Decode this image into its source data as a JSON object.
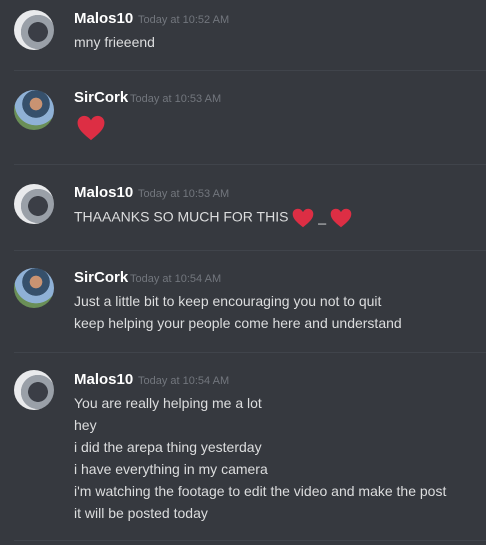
{
  "messages": [
    {
      "username": "Malos10",
      "timestamp": "Today at 10:52 AM",
      "lines": [
        "mny frieeend"
      ]
    },
    {
      "username": "SirCork",
      "timestamp": "Today at 10:53 AM",
      "emoji": "heart"
    },
    {
      "username": "Malos10",
      "timestamp": "Today at 10:53 AM",
      "text_prefix": "THAAANKS SO MUCH FOR THIS",
      "separator": "_"
    },
    {
      "username": "SirCork",
      "timestamp": "Today at 10:54 AM",
      "lines": [
        "Just a little bit to keep encouraging you not to quit",
        "keep helping your people come here and understand"
      ]
    },
    {
      "username": "Malos10",
      "timestamp": "Today at 10:54 AM",
      "lines": [
        "You are really helping me a lot",
        "hey",
        "i did the arepa thing yesterday",
        "i have everything in my camera",
        "i'm watching the footage to edit the video and make the post",
        "it will be posted today"
      ]
    }
  ],
  "colors": {
    "background": "#36393f",
    "username": "#ffffff",
    "timestamp": "#72767d",
    "text": "#dcddde",
    "heart": "#dd2e44"
  }
}
